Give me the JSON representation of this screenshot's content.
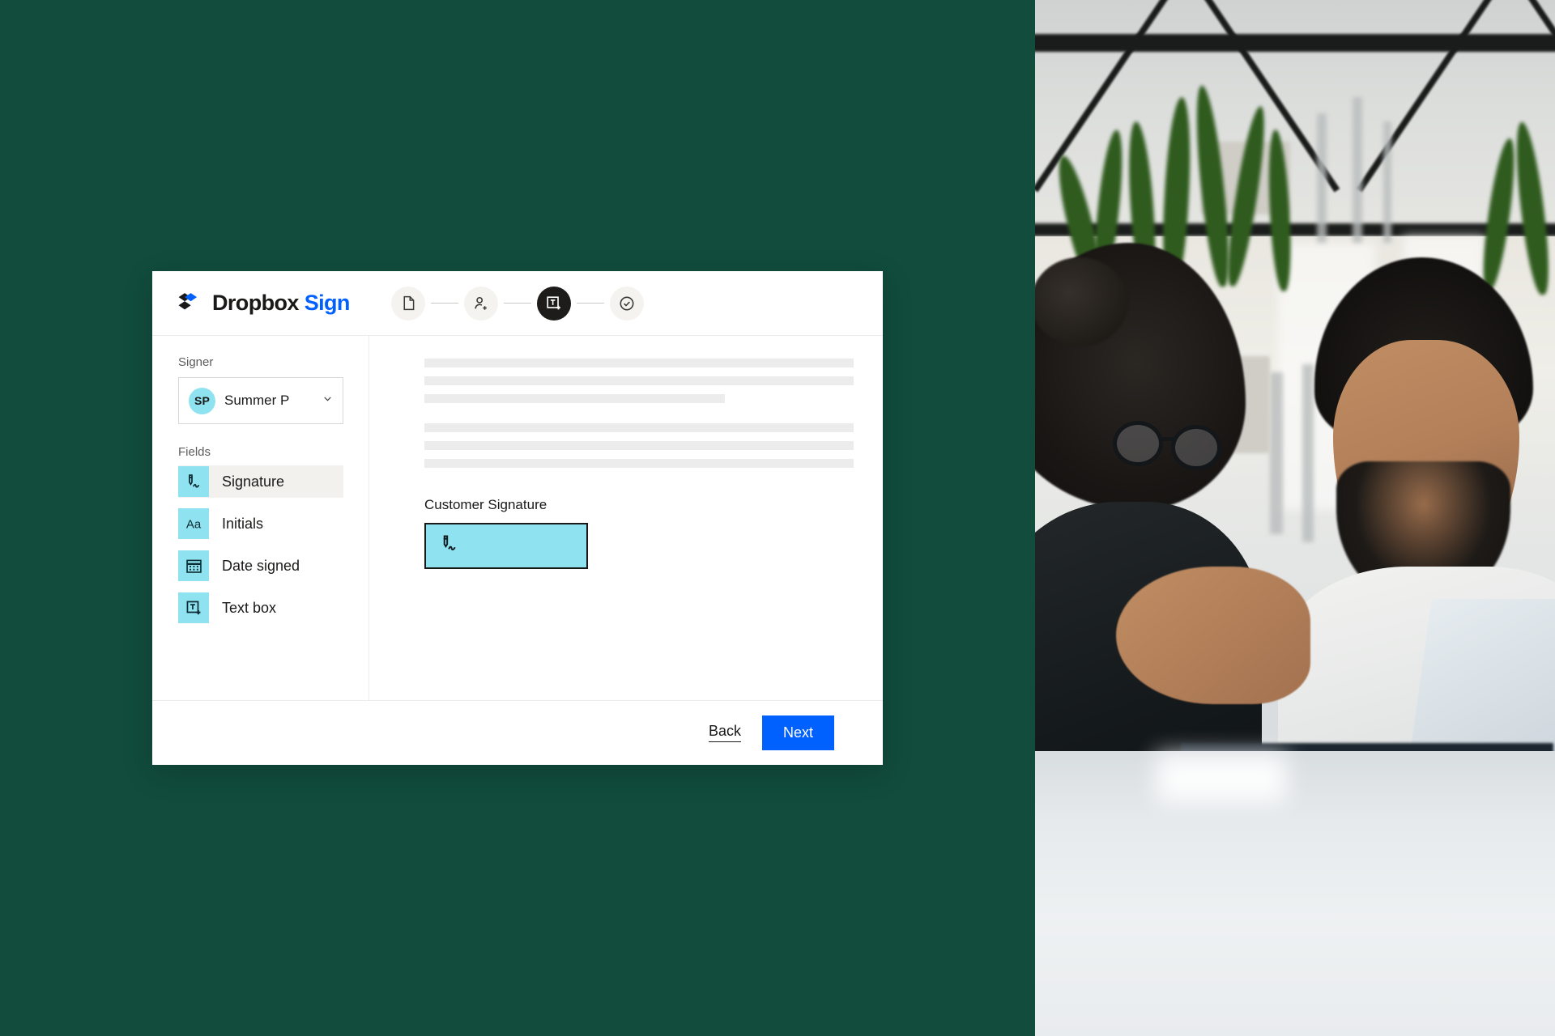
{
  "theme": {
    "background_green": "#114c3c",
    "accent_blue": "#0061ff",
    "field_cyan": "#8fe2ef",
    "ink": "#1a1918"
  },
  "brand": {
    "logo_icon": "dropbox-logo-icon",
    "name": "Dropbox",
    "product": "Sign"
  },
  "stepper": {
    "steps": [
      {
        "icon": "document-icon",
        "label": "Document",
        "active": false
      },
      {
        "icon": "add-person-icon",
        "label": "Signers",
        "active": false
      },
      {
        "icon": "text-box-add-icon",
        "label": "Fields",
        "active": true
      },
      {
        "icon": "check-circle-icon",
        "label": "Review",
        "active": false
      }
    ]
  },
  "sidebar": {
    "signer_label": "Signer",
    "signer": {
      "initials": "SP",
      "name": "Summer P",
      "chevron_icon": "chevron-down-icon"
    },
    "fields_label": "Fields",
    "fields": [
      {
        "icon": "signature-icon",
        "label": "Signature",
        "selected": true
      },
      {
        "icon": "initials-aa-icon",
        "label": "Initials",
        "selected": false
      },
      {
        "icon": "calendar-icon",
        "label": "Date signed",
        "selected": false
      },
      {
        "icon": "text-box-add-icon",
        "label": "Text box",
        "selected": false
      }
    ]
  },
  "document": {
    "placeholder_lines": [
      {
        "width_pct": 100
      },
      {
        "width_pct": 100
      },
      {
        "width_pct": 70
      },
      {
        "gap": true
      },
      {
        "width_pct": 100
      },
      {
        "width_pct": 100
      },
      {
        "width_pct": 100
      }
    ],
    "signature_field": {
      "label": "Customer Signature",
      "icon": "signature-icon"
    }
  },
  "footer": {
    "back_label": "Back",
    "next_label": "Next"
  },
  "photo": {
    "alt": "Two colleagues smiling at a laptop in a bright modern office with plants"
  }
}
